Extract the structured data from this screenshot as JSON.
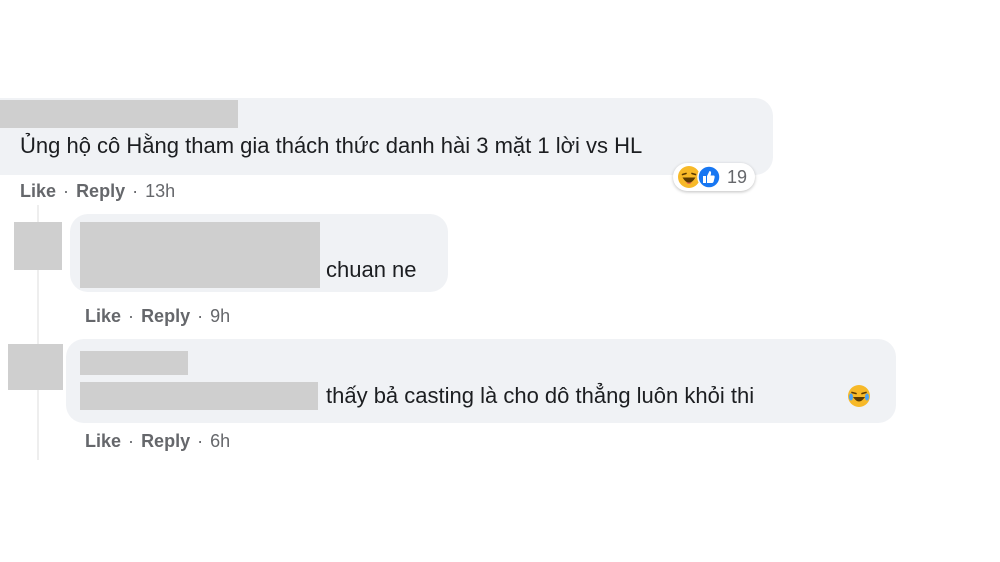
{
  "comments": [
    {
      "text": "Ủng hộ cô Hằng tham gia thách thức danh hài 3 mặt 1 lời vs HL",
      "like": "Like",
      "reply": "Reply",
      "time": "13h",
      "reaction_count": "19",
      "reactions": [
        "haha-icon",
        "like-icon"
      ]
    },
    {
      "text": "chuan ne",
      "like": "Like",
      "reply": "Reply",
      "time": "9h"
    },
    {
      "text": "thấy bả casting là cho dô thẳng luôn khỏi thi",
      "like": "Like",
      "reply": "Reply",
      "time": "6h",
      "emoji": "laughing-crying-icon"
    }
  ],
  "separator": "·",
  "colors": {
    "bubble": "#f0f2f5",
    "meta_text": "#65676b",
    "like_blue": "#1877f2",
    "haha_yellow": "#f7b928",
    "redaction": "#cfcfcf"
  }
}
